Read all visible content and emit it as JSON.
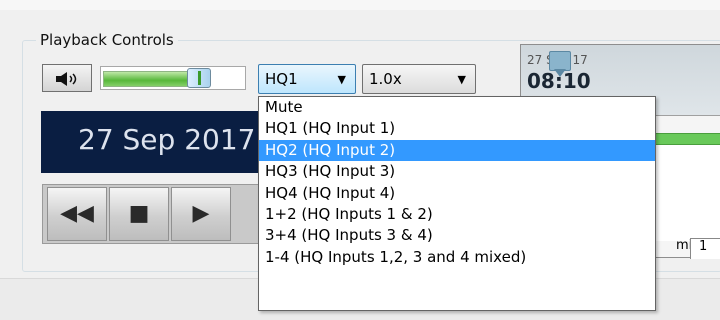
{
  "playback": {
    "group_title": "Playback Controls",
    "volume_level": 0.78,
    "channel_select": "HQ1",
    "speed_select": "1.0x",
    "date_display": "27 Sep 2017"
  },
  "channel_menu": {
    "items": [
      "Mute",
      "HQ1  (HQ Input 1)",
      "HQ2  (HQ Input 2)",
      "HQ3  (HQ Input 3)",
      "HQ4  (HQ Input 4)",
      "1+2  (HQ Inputs 1 & 2)",
      "3+4  (HQ Inputs 3 & 4)",
      "1-4  (HQ Inputs 1,2, 3 and 4 mixed)"
    ],
    "highlighted": "HQ2  (HQ Input 2)"
  },
  "timeline": {
    "date_label": "27 Sep 17",
    "time_label": "08:10",
    "tab_label": "mins",
    "tab2_label": "1"
  },
  "transport": {
    "rewind_icon": "rewind-icon",
    "stop_icon": "stop-icon",
    "play_icon": "play-icon"
  },
  "colors": {
    "date_bg": "#0a1e42",
    "menu_highlight": "#3399ff",
    "volume_green": "#57b83a"
  }
}
